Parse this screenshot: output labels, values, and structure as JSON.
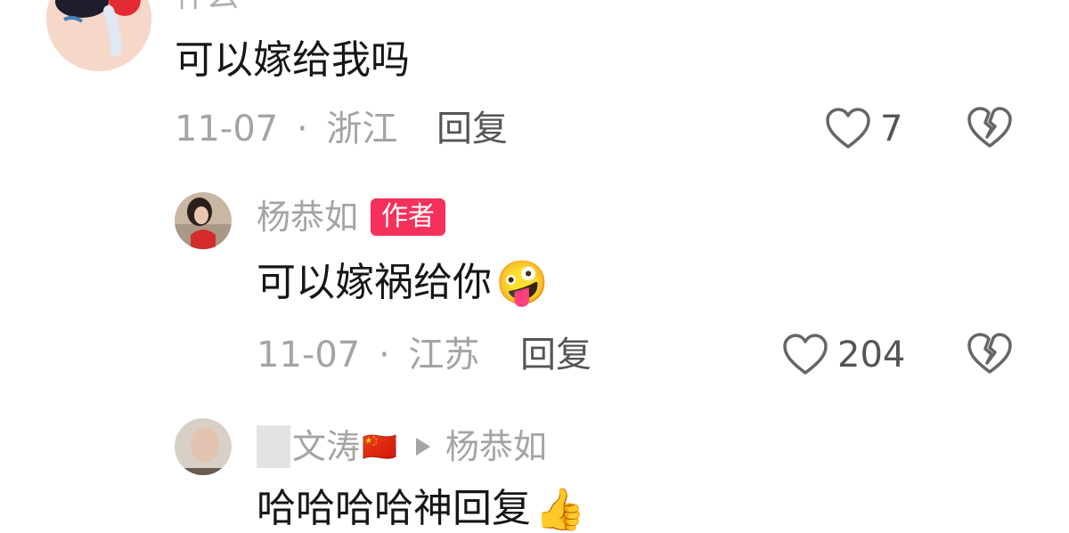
{
  "comments": [
    {
      "username_partial": "什么",
      "text": "可以嫁给我吗",
      "date": "11-07",
      "location": "浙江",
      "reply_label": "回复",
      "likes": "7"
    },
    {
      "username": "杨恭如",
      "badge": "作者",
      "text": "可以嫁祸给你",
      "emoji": "🤪",
      "date": "11-07",
      "location": "江苏",
      "reply_label": "回复",
      "likes": "204"
    },
    {
      "username_partial": "文涛",
      "flag": "🇨🇳",
      "reply_to": "杨恭如",
      "text": "哈哈哈哈神回复",
      "emoji": "👍"
    }
  ],
  "separator": "·",
  "colors": {
    "accent_badge": "#f5305a",
    "muted": "#a4a4a4",
    "text": "#161616"
  }
}
